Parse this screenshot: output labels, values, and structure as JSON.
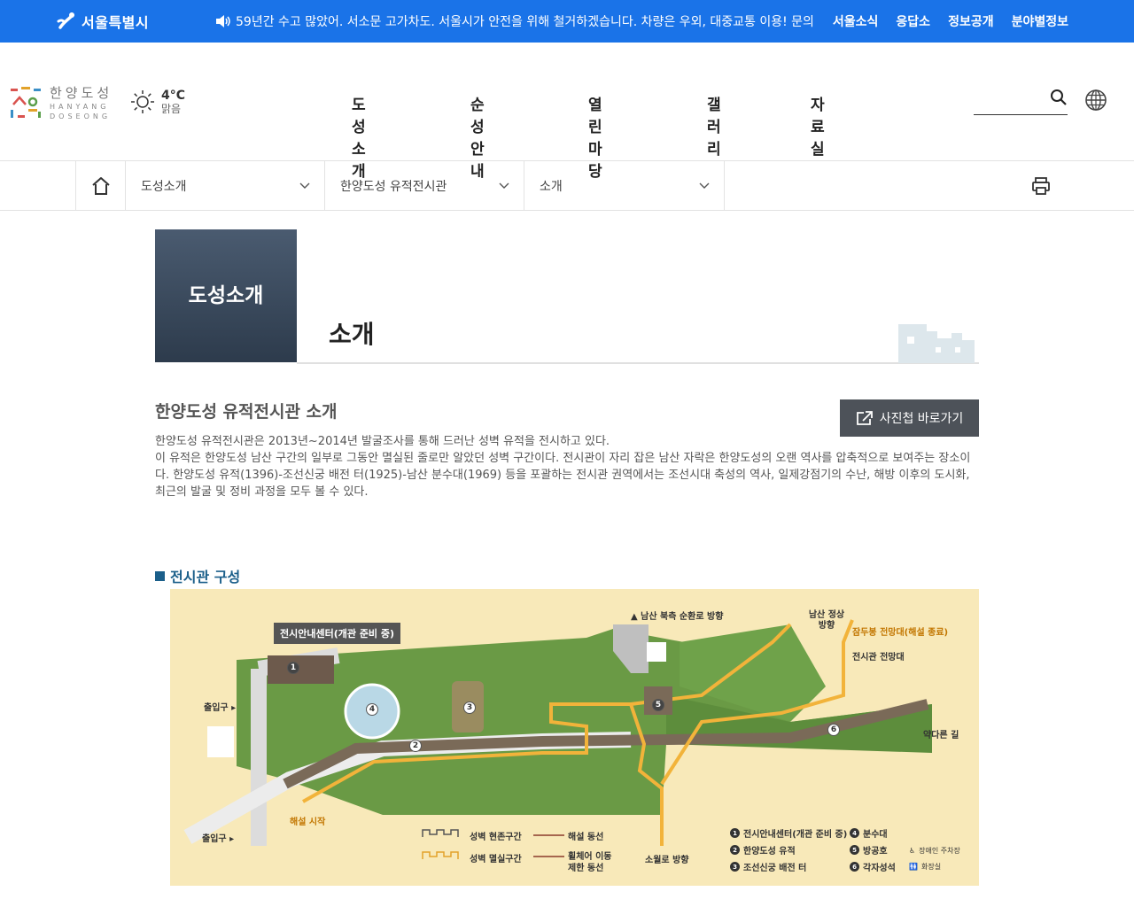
{
  "topbar": {
    "city_name": "서울특별시",
    "notice": "59년간 수고 많았어. 서소문 고가차도. 서울시가 안전을 위해 철거하겠습니다. 차량은 우외, 대중교통 이용! 문의 …",
    "links": [
      "서울소식",
      "응답소",
      "정보공개",
      "분야별정보"
    ]
  },
  "header": {
    "logo_kor": "한양도성",
    "logo_eng_1": "HANYANG",
    "logo_eng_2": "DOSEONG",
    "weather_temp": "4°C",
    "weather_condition": "맑음",
    "gnb": [
      "도성소개",
      "순성안내",
      "열린마당",
      "갤러리",
      "자료실"
    ],
    "search_placeholder": ""
  },
  "breadcrumb": {
    "items": [
      "도성소개",
      "한양도성 유적전시관",
      "소개"
    ]
  },
  "page": {
    "category": "도성소개",
    "title": "소개",
    "section_heading": "한양도성 유적전시관 소개",
    "album_button": "사진첩 바로가기",
    "description_1": "한양도성 유적전시관은 2013년~2014년 발굴조사를 통해 드러난 성벽 유적을 전시하고 있다.",
    "description_2": "이 유적은 한양도성 남산 구간의 일부로 그동안 멸실된 줄로만 알았던 성벽 구간이다. 전시관이 자리 잡은 남산 자락은 한양도성의 오랜 역사를 압축적으로 보여주는 장소이다. 한양도성 유적(1396)-조선신궁 배전 터(1925)-남산 분수대(1969) 등을 포괄하는 전시관 권역에서는 조선시대 축성의 역사, 일제강점기의 수난, 해방 이후의 도시화, 최근의 발굴 및 정비 과정을 모두 볼 수 있다.",
    "sub_heading": "전시관 구성"
  },
  "map": {
    "center_label": "전시안내센터(개관 준비 중)",
    "north_loop": "▲ 남산 북측 순환로 방향",
    "summit": "남산 정상 방향",
    "jamdubong": "잠두봉 전망대(해설 종료)",
    "viewpoint": "전시관 전망대",
    "exit_top": "출입구 ▸",
    "exit_bottom": "출입구 ▸",
    "start": "해설 시작",
    "yakdoreun": "약다른 길",
    "sowollo": "소월로 방향",
    "legend_exist": "성벽 현존구간",
    "legend_lost": "성벽 멸실구간",
    "legend_route": "해설 동선",
    "legend_wheel_1": "휠체어 이동",
    "legend_wheel_2": "제한 동선",
    "items": [
      "전시안내센터(개관 준비 중)",
      "한양도성 유적",
      "조선신궁 배전 터",
      "분수대",
      "방공호",
      "각자성석"
    ],
    "icon_legend_1": "장애인 주차장",
    "icon_legend_2": "화장실"
  }
}
